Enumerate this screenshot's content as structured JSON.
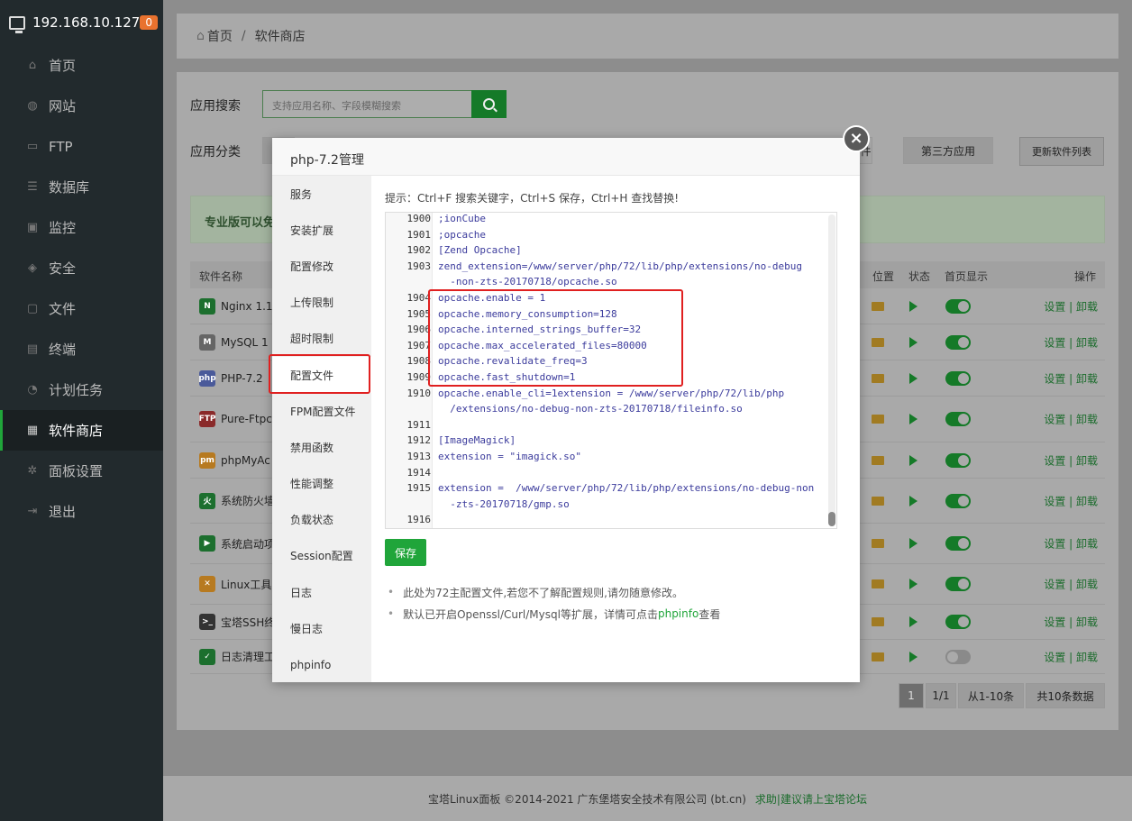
{
  "sidebar": {
    "host": "192.168.10.127",
    "badge": "0",
    "items": [
      {
        "label": "首页",
        "icon": "home-icon"
      },
      {
        "label": "网站",
        "icon": "globe-icon"
      },
      {
        "label": "FTP",
        "icon": "ftp-icon"
      },
      {
        "label": "数据库",
        "icon": "database-icon"
      },
      {
        "label": "监控",
        "icon": "monitor-icon"
      },
      {
        "label": "安全",
        "icon": "shield-icon"
      },
      {
        "label": "文件",
        "icon": "folder-icon"
      },
      {
        "label": "终端",
        "icon": "terminal-icon"
      },
      {
        "label": "计划任务",
        "icon": "clock-icon"
      },
      {
        "label": "软件商店",
        "icon": "grid-icon",
        "active": true
      },
      {
        "label": "面板设置",
        "icon": "gear-icon"
      },
      {
        "label": "退出",
        "icon": "logout-icon"
      }
    ]
  },
  "breadcrumb": {
    "home": "首页",
    "sep": "/",
    "current": "软件商店"
  },
  "store": {
    "search_label": "应用搜索",
    "search_placeholder": "支持应用名称、字段模糊搜索",
    "category_label": "应用分类",
    "cat_partial": "件",
    "cat_third_party": "第三方应用",
    "update_button": "更新软件列表",
    "alert_text": "专业版可以免",
    "table_headers": {
      "name": "软件名称",
      "location": "位置",
      "status": "状态",
      "homepage": "首页显示",
      "actions": "操作"
    },
    "rows": [
      {
        "name": "Nginx 1.1",
        "icon_text": "N",
        "icon_color": "#1c6f2e",
        "on": true
      },
      {
        "name": "MySQL 1",
        "icon_text": "M",
        "icon_color": "#666666",
        "on": true
      },
      {
        "name": "PHP-7.2",
        "icon_text": "php",
        "icon_color": "#4a5a9a",
        "on": true
      },
      {
        "name": "Pure-Ftpc",
        "icon_text": "FTP",
        "icon_color": "#8a2a2a",
        "on": true
      },
      {
        "name": "phpMyAc",
        "icon_text": "pm",
        "icon_color": "#b77a20",
        "on": true
      },
      {
        "name": "系统防火墙",
        "icon_text": "火",
        "icon_color": "#1c6f2e",
        "on": true
      },
      {
        "name": "系统启动项",
        "icon_text": "▶",
        "icon_color": "#1c6f2e",
        "on": true
      },
      {
        "name": "Linux工具",
        "icon_text": "✕",
        "icon_color": "#b77a20",
        "on": true
      },
      {
        "name": "宝塔SSH终",
        "icon_text": ">_",
        "icon_color": "#333333",
        "on": true
      },
      {
        "name": "日志清理工",
        "icon_text": "✓",
        "icon_color": "#1c6f2e",
        "on": false
      }
    ],
    "row_actions": "设置 | 卸载",
    "pager": {
      "current": "1",
      "pages": "1/1",
      "range": "从1-10条",
      "total": "共10条数据"
    }
  },
  "modal": {
    "title": "php-7.2管理",
    "close": "×",
    "nav": [
      "服务",
      "安装扩展",
      "配置修改",
      "上传限制",
      "超时限制",
      "配置文件",
      "FPM配置文件",
      "禁用函数",
      "性能调整",
      "负载状态",
      "Session配置",
      "日志",
      "慢日志",
      "phpinfo"
    ],
    "selected_nav": "配置文件",
    "hint": "提示：Ctrl+F 搜索关键字，Ctrl+S 保存，Ctrl+H 查找替换!",
    "code_lines": [
      {
        "ln": "1900",
        "text": ";ionCube"
      },
      {
        "ln": "1901",
        "text": ";opcache"
      },
      {
        "ln": "1902",
        "text": "[Zend Opcache]"
      },
      {
        "ln": "1903",
        "text": "zend_extension=/www/server/php/72/lib/php/extensions/no-debug"
      },
      {
        "ln": "",
        "text": "  -non-zts-20170718/opcache.so"
      },
      {
        "ln": "1904",
        "text": "opcache.enable = 1"
      },
      {
        "ln": "1905",
        "text": "opcache.memory_consumption=128"
      },
      {
        "ln": "1906",
        "text": "opcache.interned_strings_buffer=32"
      },
      {
        "ln": "1907",
        "text": "opcache.max_accelerated_files=80000"
      },
      {
        "ln": "1908",
        "text": "opcache.revalidate_freq=3"
      },
      {
        "ln": "1909",
        "text": "opcache.fast_shutdown=1"
      },
      {
        "ln": "1910",
        "text": "opcache.enable_cli=1extension = /www/server/php/72/lib/php"
      },
      {
        "ln": "",
        "text": "  /extensions/no-debug-non-zts-20170718/fileinfo.so"
      },
      {
        "ln": "1911",
        "text": ""
      },
      {
        "ln": "1912",
        "text": "[ImageMagick]"
      },
      {
        "ln": "1913",
        "text": "extension = \"imagick.so\""
      },
      {
        "ln": "1914",
        "text": ""
      },
      {
        "ln": "1915",
        "text": "extension =  /www/server/php/72/lib/php/extensions/no-debug-non"
      },
      {
        "ln": "",
        "text": "  -zts-20170718/gmp.so"
      },
      {
        "ln": "1916",
        "text": ""
      }
    ],
    "save_button": "保存",
    "note1": "此处为72主配置文件,若您不了解配置规则,请勿随意修改。",
    "note2_prefix": "默认已开启Openssl/Curl/Mysql等扩展，详情可点击",
    "note2_link": "phpinfo",
    "note2_suffix": "查看"
  },
  "footer": {
    "copyright": "宝塔Linux面板 ©2014-2021 广东堡塔安全技术有限公司 (bt.cn)",
    "link": "求助|建议请上宝塔论坛"
  },
  "colors": {
    "accent": "#20a53a",
    "highlight": "#e02020"
  }
}
